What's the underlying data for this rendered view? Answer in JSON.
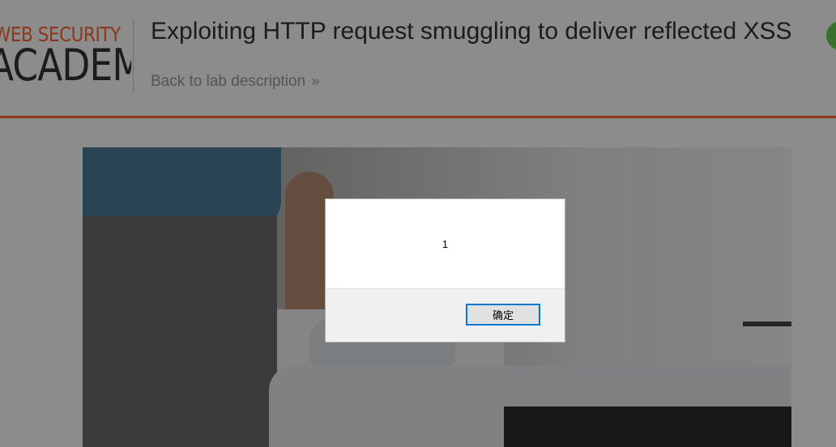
{
  "header": {
    "logo_top": "WEB SECURITY",
    "logo_bottom": "ACADEMY",
    "lab_title": "Exploiting HTTP request smuggling to deliver reflected XSS",
    "back_link": "Back to lab description",
    "back_link_icon": "double-chevron-right-icon",
    "status_color": "#66cc55"
  },
  "colors": {
    "accent": "#ff6633",
    "title_text": "#333333",
    "link_text": "#999999",
    "dialog_button_border": "#0078d7"
  },
  "hero": {
    "image": "ironing-board-photo"
  },
  "dialog": {
    "message": "1",
    "ok_label": "确定"
  }
}
